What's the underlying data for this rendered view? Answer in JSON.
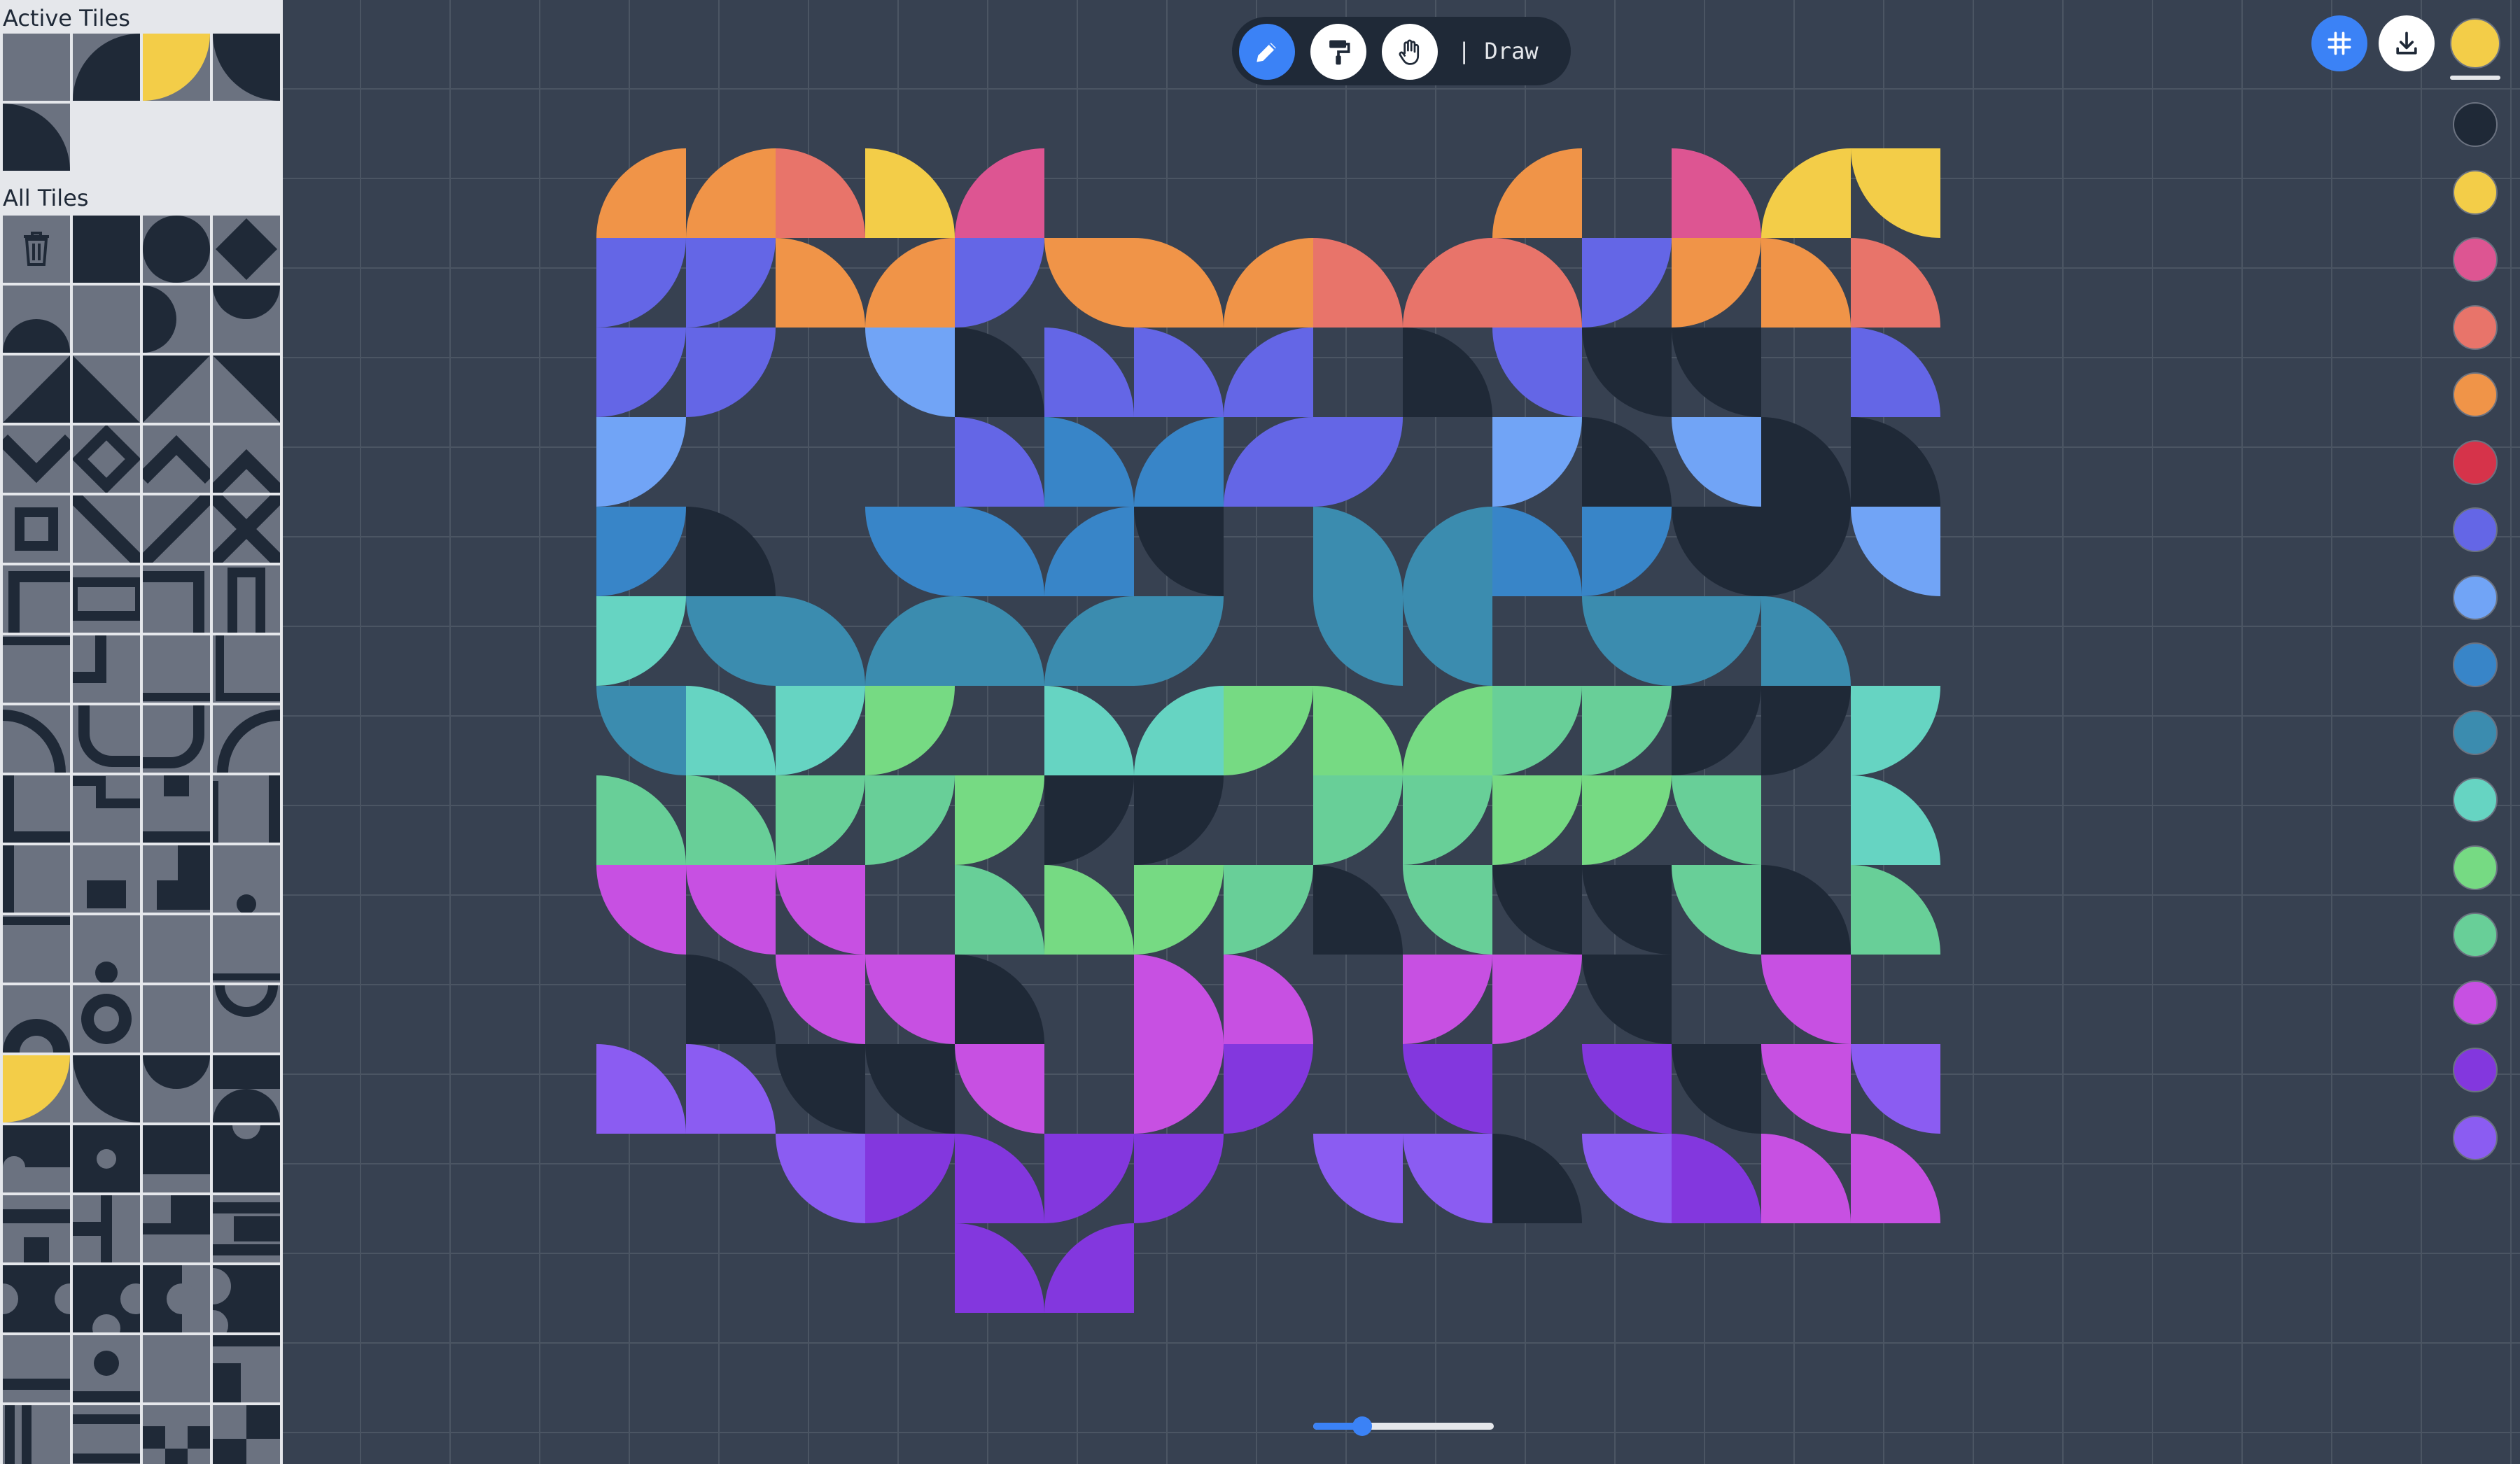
{
  "sidebar": {
    "active_title": "Active Tiles",
    "all_title": "All Tiles",
    "active_tiles": [
      "blank",
      "quarter-br-dark",
      "quarter-tl-yellow",
      "quarter-tr-dark",
      "quarter-bl-dark"
    ],
    "selected_tile_row": 12,
    "selected_tile_col": 0
  },
  "toolbar": {
    "tools": [
      {
        "name": "pencil-icon",
        "active": true
      },
      {
        "name": "paint-roller-icon",
        "active": false
      },
      {
        "name": "hand-icon",
        "active": false
      }
    ],
    "mode_label": "| Draw"
  },
  "corner_buttons": [
    {
      "name": "grid-toggle-icon",
      "active": true
    },
    {
      "name": "download-icon",
      "active": false
    }
  ],
  "current_color": "#f3cd48",
  "palette": [
    "#1f2937",
    "#f3cd48",
    "#dd5592",
    "#e8746a",
    "#f09448",
    "#d6334a",
    "#6466e6",
    "#71a4f6",
    "#3885c8",
    "#3b8caf",
    "#66d4c2",
    "#76da83",
    "#68cf98",
    "#c750e2",
    "#8337de",
    "#8b5cf2"
  ],
  "zoom": 0.27,
  "colors": {
    "X": "#1f2937",
    "Y": "#f3cd48",
    "K": "#dd5592",
    "S": "#e8746a",
    "O": "#f09448",
    "R": "#d6334a",
    "I": "#6466e6",
    "L": "#71a4f6",
    "B": "#3885c8",
    "T": "#3b8caf",
    "C": "#66d4c2",
    "G": "#76da83",
    "M": "#68cf98",
    "P": "#c750e2",
    "V": "#8337de",
    "U": "#8b5cf2"
  },
  "tile_codes": [
    "O3 O3 S4 Y4 K3 __ __ __ __ __ O3 __ K4 Y3 Y2",
    "I1 I1 O4 O3 I1 O2 O4 O3 S4 S3 S4 I1 O1 O4 S4",
    "I1 I1 __ L2 X4 I4 I4 I3 __ X4 I2 X2 X2 __ I4",
    "L1 __ __ __ I4 B4 B3 I3 I1 __ L1 X4 L2 X4 X4",
    "B1 X4 __ B2 B4 B3 X2 __ T4 T3 B4 B1 X2 X1 L2",
    "C1 T2 T4 T3 T4 T3 T1 __ T2 T2 __ T2 T1 T4 __",
    "T2 C4 C1 G1 __ C4 C3 G1 G4 G3 M1 M1 X1 X1 C1",
    "M4 M4 M1 M1 G1 X1 X1 __ M1 M1 G1 G1 M2 __ C4",
    "P2 P2 P2 __ M4 G4 G1 M1 X4 M2 X2 X2 M2 X4 M4",
    "__ X4 P2 P2 X4 __ P4 P4 __ P1 P1 X2 __ P2 __",
    "U4 U4 X2 X2 P2 __ P1 V1 __ V2 __ V2 X2 P2 U2",
    "__ __ U2 V1 V4 V1 V1 __ U2 U2 X4 U2 V4 P4 P4",
    "__ __ __ __ V4 V3 __ __ __ __ __ __ __ __ __"
  ]
}
